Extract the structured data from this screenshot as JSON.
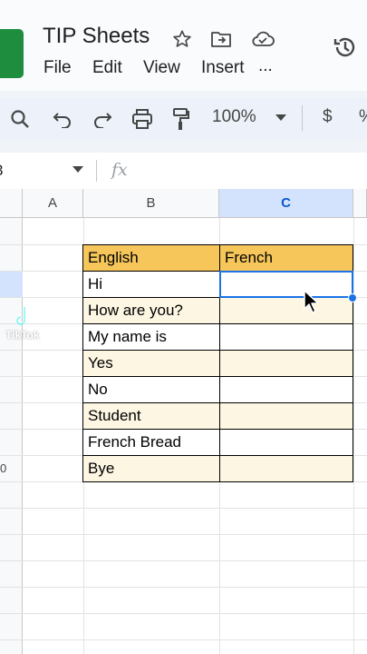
{
  "app": {
    "title": "TIP Sheets",
    "menu": [
      "File",
      "Edit",
      "View",
      "Insert",
      "..."
    ]
  },
  "toolbar": {
    "zoom": "100%",
    "currency": "$",
    "percent": "%"
  },
  "formula_bar": {
    "name_box": "3",
    "fx_label": "fx"
  },
  "sheet": {
    "columns": [
      "A",
      "B",
      "C"
    ],
    "row_label_visible": "0",
    "table": {
      "headers": [
        "English",
        "French"
      ],
      "rows": [
        {
          "english": "Hi",
          "french": ""
        },
        {
          "english": "How are you?",
          "french": ""
        },
        {
          "english": "My name is",
          "french": ""
        },
        {
          "english": "Yes",
          "french": ""
        },
        {
          "english": "No",
          "french": ""
        },
        {
          "english": "Student",
          "french": ""
        },
        {
          "english": "French Bread",
          "french": ""
        },
        {
          "english": "Bye",
          "french": ""
        }
      ]
    }
  },
  "watermark": "TikTok",
  "colors": {
    "header_fill": "#f6c65b",
    "alt_row_fill": "#fdf6e3",
    "selected_border": "#1a73e8",
    "selected_col_header": "#d3e3fd"
  }
}
